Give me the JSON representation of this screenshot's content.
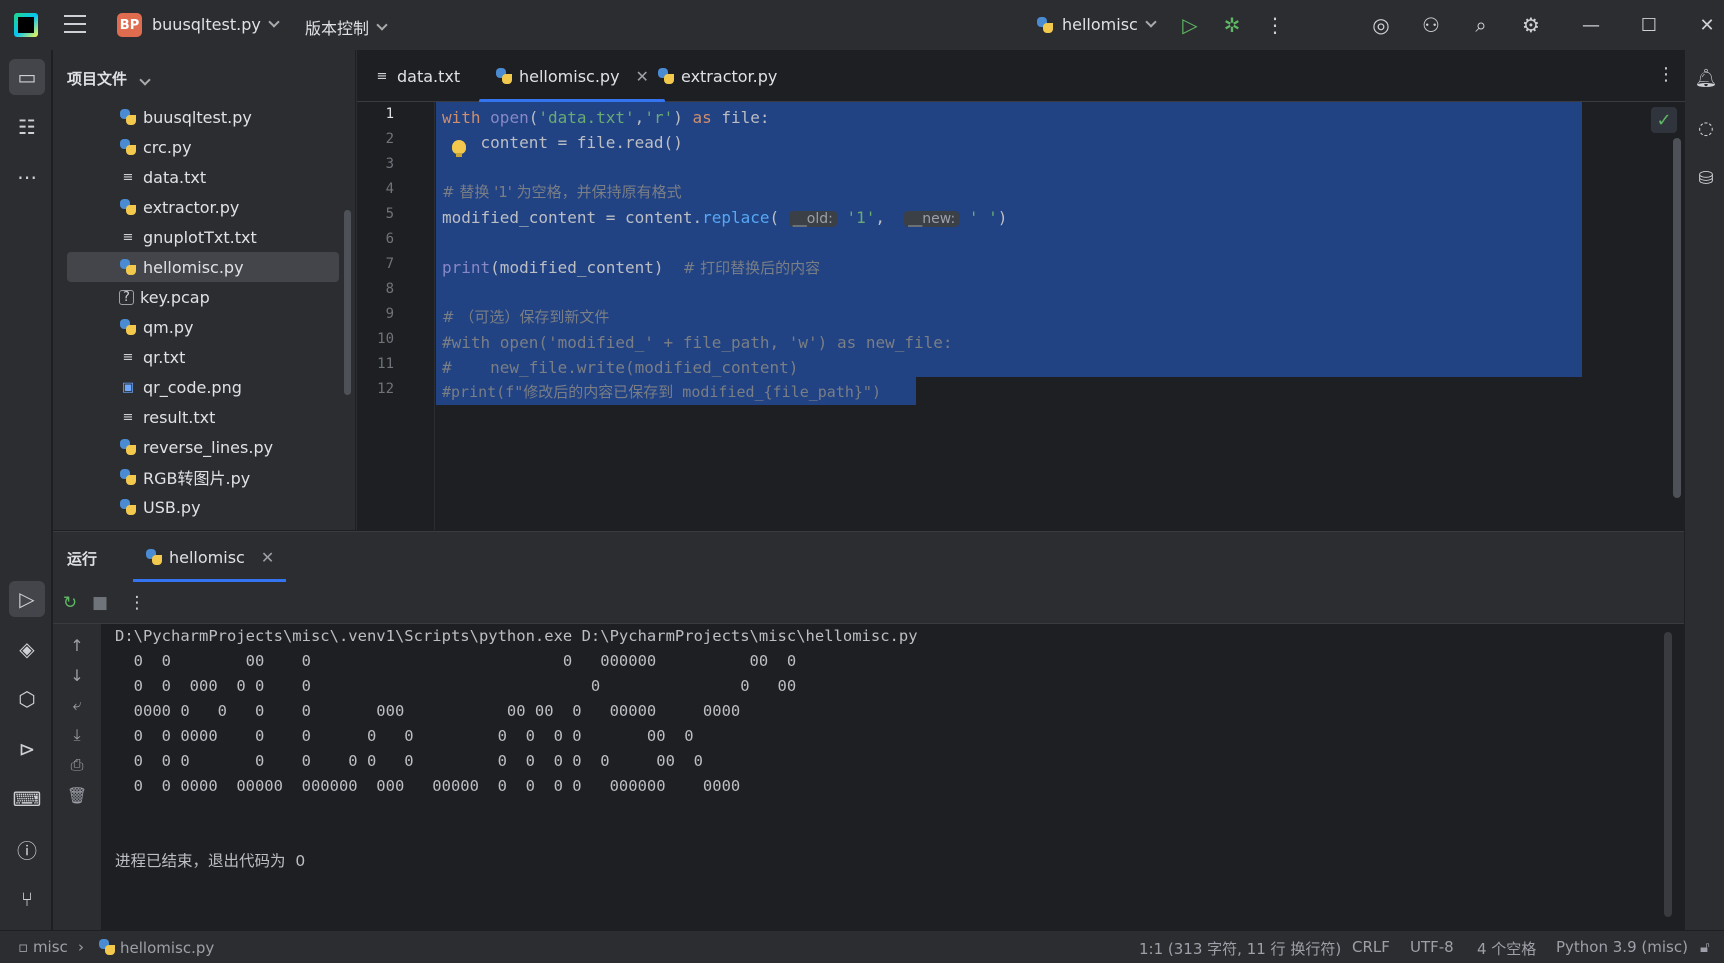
{
  "titlebar": {
    "project_badge": "BP",
    "project_name": "buusqltest.py",
    "vcs_label": "版本控制",
    "run_config": "hellomisc"
  },
  "project": {
    "header": "项目文件",
    "files": [
      {
        "name": "buusqltest.py",
        "type": "python"
      },
      {
        "name": "crc.py",
        "type": "python"
      },
      {
        "name": "data.txt",
        "type": "text"
      },
      {
        "name": "extractor.py",
        "type": "python"
      },
      {
        "name": "gnuplotTxt.txt",
        "type": "text"
      },
      {
        "name": "hellomisc.py",
        "type": "python",
        "selected": true
      },
      {
        "name": "key.pcap",
        "type": "unknown"
      },
      {
        "name": "qm.py",
        "type": "python"
      },
      {
        "name": "qr.txt",
        "type": "text"
      },
      {
        "name": "qr_code.png",
        "type": "image"
      },
      {
        "name": "result.txt",
        "type": "text"
      },
      {
        "name": "reverse_lines.py",
        "type": "python"
      },
      {
        "name": "RGB转图片.py",
        "type": "python"
      },
      {
        "name": "USB.py",
        "type": "python"
      }
    ]
  },
  "editor": {
    "tabs": [
      {
        "label": "data.txt",
        "active": false
      },
      {
        "label": "hellomisc.py",
        "active": true
      },
      {
        "label": "extractor.py",
        "active": false
      }
    ],
    "line_numbers": [
      "1",
      "2",
      "3",
      "4",
      "5",
      "6",
      "7",
      "8",
      "9",
      "10",
      "11",
      "12"
    ],
    "code": {
      "l1_kw_with": "with",
      "l1_open": "open",
      "l1_paren": "(",
      "l1_str1": "'data.txt'",
      "l1_comma": ",",
      "l1_str2": "'r'",
      "l1_rest1": ") ",
      "l1_kw_as": "as",
      "l1_rest2": " file:",
      "l2": "    content = file.read()",
      "l4": "# 替换 '1' 为空格，并保持原有格式",
      "l5_a": "modified_content = content.",
      "l5_fn": "replace",
      "l5_b": "( ",
      "l5_hint_old": "__old:",
      "l5_str1": " '1'",
      "l5_c": ",  ",
      "l5_hint_new": "__new:",
      "l5_str2": " ' '",
      "l5_d": ")",
      "l7_print": "print",
      "l7_rest": "(modified_content)  ",
      "l7_cm": "# 打印替换后的内容",
      "l9": "# （可选）保存到新文件",
      "l10": "#with open('modified_' + file_path, 'w') as new_file:",
      "l11": "#    new_file.write(modified_content)",
      "l12": "#print(f\"修改后的内容已保存到 modified_{file_path}\")"
    }
  },
  "run": {
    "title": "运行",
    "tab_label": "hellomisc",
    "console": [
      "D:\\PycharmProjects\\misc\\.venv1\\Scripts\\python.exe D:\\PycharmProjects\\misc\\hellomisc.py",
      "  0  0        00    0                           0   000000          00  0",
      "  0  0  000  0 0    0                              0               0   00",
      "  0000 0   0   0    0       000           00 00  0   00000     0000",
      "  0  0 0000    0    0      0   0         0  0  0 0       00  0",
      "  0  0 0       0    0    0 0   0         0  0  0 0  0     00  0",
      "  0  0 0000  00000  000000  000   00000  0  0  0 0   000000    0000",
      "",
      "",
      "进程已结束，退出代码为  0"
    ]
  },
  "statusbar": {
    "project": "misc",
    "file": "hellomisc.py",
    "position": "1:1 (313 字符, 11 行 换行符)",
    "line_sep": "CRLF",
    "encoding": "UTF-8",
    "indent": "4 个空格",
    "interpreter": "Python 3.9 (misc)"
  },
  "colors": {
    "accent": "#3574f0",
    "selection": "#214283",
    "keyword": "#cf8e6d",
    "string": "#6aab73",
    "comment": "#7a7e85"
  }
}
